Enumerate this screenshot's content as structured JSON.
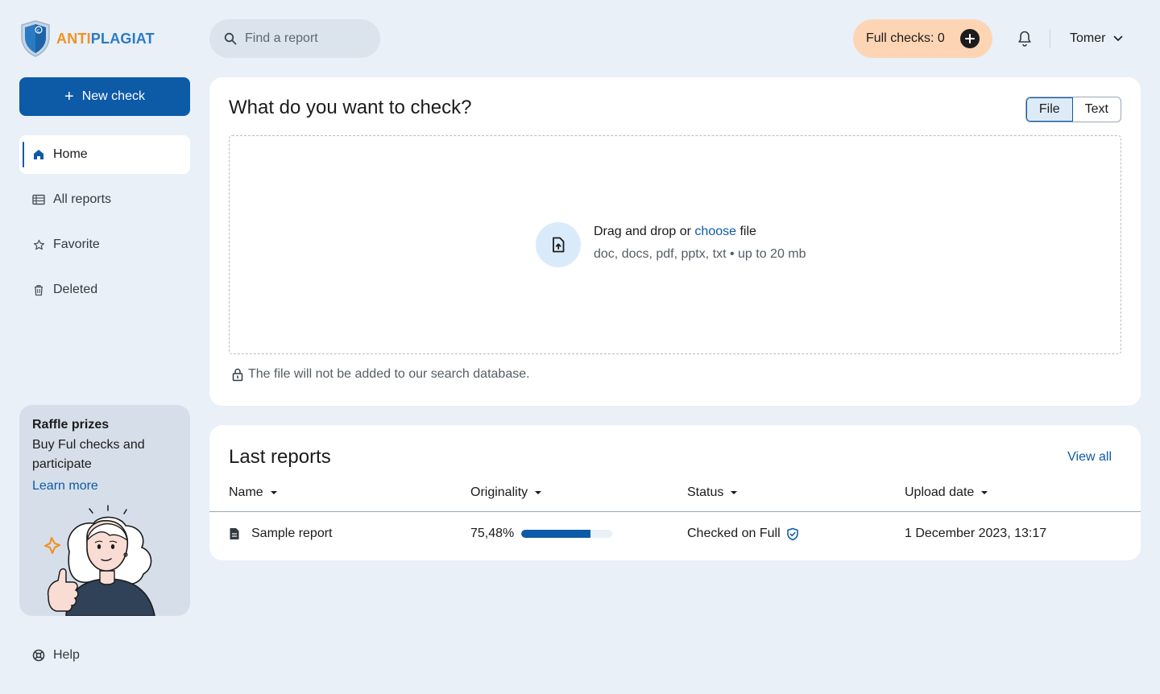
{
  "brand": {
    "logo_part1": "ANTI",
    "logo_part2": "PLAGIAT",
    "accent": "#0d5aa7",
    "orange": "#f29222"
  },
  "header": {
    "search_placeholder": "Find a report",
    "full_checks_label": "Full checks: 0",
    "user_name": "Tomer"
  },
  "sidebar": {
    "new_check_label": "New check",
    "items": [
      {
        "label": "Home",
        "icon": "home-icon",
        "active": true
      },
      {
        "label": "All reports",
        "icon": "list-icon"
      },
      {
        "label": "Favorite",
        "icon": "star-icon"
      },
      {
        "label": "Deleted",
        "icon": "trash-icon"
      }
    ],
    "promo": {
      "title": "Raffle prizes",
      "text": "Buy Ful checks and participate",
      "link": "Learn more"
    },
    "help_label": "Help"
  },
  "upload": {
    "title": "What do you want to check?",
    "tabs": [
      "File",
      "Text"
    ],
    "selected_tab": "File",
    "drop_text_before": "Drag and drop or",
    "drop_link": "choose",
    "drop_text_after": "file",
    "formats": "doc, docs, pdf, pptx, txt • up to 20 mb",
    "privacy_note": "The file will not be added to our search database."
  },
  "reports": {
    "title": "Last reports",
    "view_all": "View all",
    "columns": [
      "Name",
      "Originality",
      "Status",
      "Upload date"
    ],
    "rows": [
      {
        "name": "Sample report",
        "originality": "75,48%",
        "originality_value": 0.7548,
        "status": "Checked on Full",
        "upload_date": "1 December 2023, 13:17"
      }
    ]
  }
}
